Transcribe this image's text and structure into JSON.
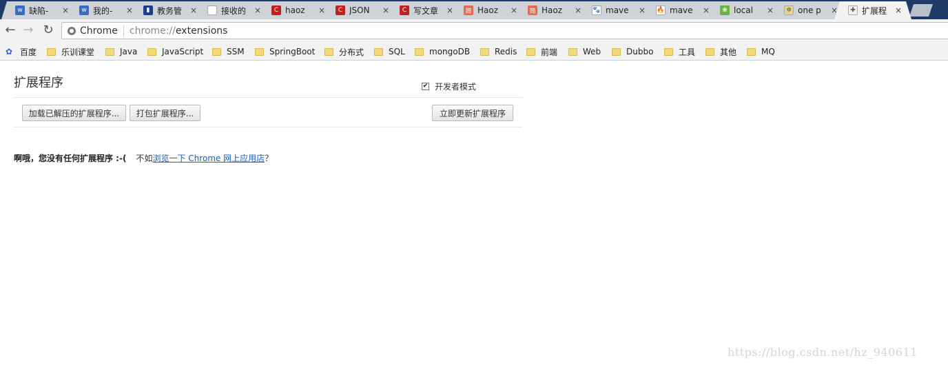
{
  "tabs": [
    {
      "title": "缺陷-",
      "icon": "w",
      "icon_color": "#3a6bc4"
    },
    {
      "title": "我的-",
      "icon": "w",
      "icon_color": "#3a6bc4"
    },
    {
      "title": "教务管",
      "icon": "▮",
      "icon_color": "#1c3b8c"
    },
    {
      "title": "接收的",
      "icon": "",
      "icon_color": "#ffffff"
    },
    {
      "title": "haoz",
      "icon": "C",
      "icon_color": "#c0201f"
    },
    {
      "title": "JSON",
      "icon": "C",
      "icon_color": "#c0201f"
    },
    {
      "title": "写文章",
      "icon": "C",
      "icon_color": "#c0201f"
    },
    {
      "title": "Haoz",
      "icon": "简",
      "icon_color": "#e06a54"
    },
    {
      "title": "Haoz",
      "icon": "简",
      "icon_color": "#e06a54"
    },
    {
      "title": "mave",
      "icon": "🐾",
      "icon_color": "#ffffff"
    },
    {
      "title": "mave",
      "icon": "🔥",
      "icon_color": "#ffffff"
    },
    {
      "title": "local",
      "icon": "❀",
      "icon_color": "#6db33f"
    },
    {
      "title": "one p",
      "icon": "✲",
      "icon_color": "#e8d28c"
    },
    {
      "title": "扩展程",
      "icon": "✚",
      "icon_color": "#f2f2f2",
      "active": true
    }
  ],
  "tab_close_glyph": "×",
  "toolbar": {
    "back_glyph": "←",
    "forward_glyph": "→",
    "reload_glyph": "↻",
    "omnibox_chip": "Chrome",
    "url_scheme": "chrome://",
    "url_path": "extensions"
  },
  "bookmarks": [
    {
      "label": "百度",
      "type": "site"
    },
    {
      "label": "乐训课堂",
      "type": "folder"
    },
    {
      "label": "Java",
      "type": "folder"
    },
    {
      "label": "JavaScript",
      "type": "folder"
    },
    {
      "label": "SSM",
      "type": "folder"
    },
    {
      "label": "SpringBoot",
      "type": "folder"
    },
    {
      "label": "分布式",
      "type": "folder"
    },
    {
      "label": "SQL",
      "type": "folder"
    },
    {
      "label": "mongoDB",
      "type": "folder"
    },
    {
      "label": "Redis",
      "type": "folder"
    },
    {
      "label": "前端",
      "type": "folder"
    },
    {
      "label": "Web",
      "type": "folder"
    },
    {
      "label": "Dubbo",
      "type": "folder"
    },
    {
      "label": "工具",
      "type": "folder"
    },
    {
      "label": "其他",
      "type": "folder"
    },
    {
      "label": "MQ",
      "type": "folder"
    }
  ],
  "page": {
    "title": "扩展程序",
    "dev_mode_label": "开发者模式",
    "dev_mode_checked": true,
    "load_unpacked_label": "加载已解压的扩展程序...",
    "pack_label": "打包扩展程序...",
    "update_label": "立即更新扩展程序",
    "empty_bold": "啊哦，您没有任何扩展程序 :-(",
    "empty_prefix": "不如",
    "empty_link": "浏览一下 Chrome 网上应用店",
    "empty_suffix": "？"
  },
  "watermark": "https://blog.csdn.net/hz_940611"
}
